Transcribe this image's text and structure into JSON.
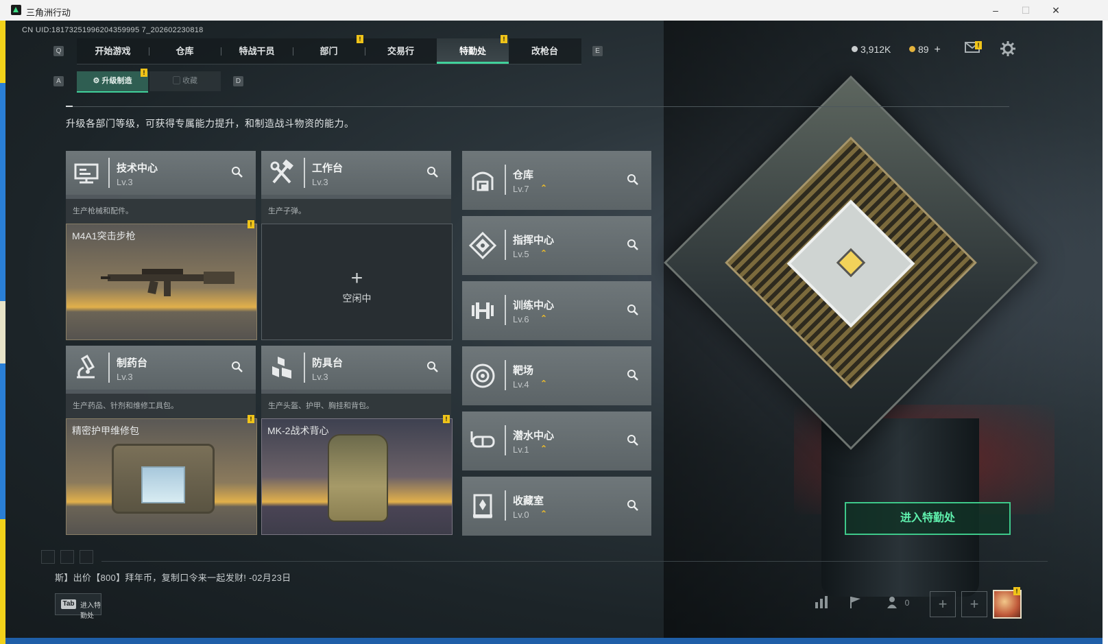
{
  "window": {
    "title": "三角洲行动",
    "minimize": "–",
    "maximize": "☐",
    "close": "✕"
  },
  "uid": "CN UID:18173251996204359995 7_202602230818",
  "nav": {
    "left_key": "Q",
    "right_key": "E",
    "tabs": [
      "开始游戏",
      "仓库",
      "特战干员",
      "部门",
      "交易行",
      "特勤处",
      "改枪台"
    ],
    "active": "特勤处",
    "warning_mark": "!"
  },
  "currency": {
    "silver": "3,912K",
    "gold": "89",
    "gold_plus": "+",
    "silver_color": "#c9cdce",
    "gold_color": "#e3b23c"
  },
  "icons": {
    "mail": "mail-icon",
    "settings": "gear-icon",
    "stats": "bar-chart-icon",
    "flag": "flag-icon",
    "friends": "friends-icon"
  },
  "subnav": {
    "left_key": "A",
    "right_key": "D",
    "tabs": [
      "升级制造",
      "收藏"
    ],
    "active": "升级制造"
  },
  "description": "升级各部门等级，可获得专属能力提升，和制造战斗物资的能力。",
  "production": [
    {
      "name": "技术中心",
      "level": "Lv.3",
      "icon": "computer-icon",
      "sub": "生产枪械和配件。",
      "item": "M4A1突击步枪",
      "state": "producing"
    },
    {
      "name": "工作台",
      "level": "Lv.3",
      "icon": "tools-icon",
      "sub": "生产子弹。",
      "item": "",
      "state": "idle",
      "idle_label": "空闲中",
      "idle_plus": "+"
    },
    {
      "name": "制药台",
      "level": "Lv.3",
      "icon": "microscope-icon",
      "sub": "生产药品、针剂和维修工具包。",
      "item": "精密护甲维修包",
      "state": "producing"
    },
    {
      "name": "防具台",
      "level": "Lv.3",
      "icon": "armor-icon",
      "sub": "生产头盔、护甲、胸挂和背包。",
      "item": "MK-2战术背心",
      "state": "producing"
    }
  ],
  "departments": [
    {
      "name": "仓库",
      "level": "Lv.7",
      "icon": "warehouse-icon"
    },
    {
      "name": "指挥中心",
      "level": "Lv.5",
      "icon": "command-icon"
    },
    {
      "name": "训练中心",
      "level": "Lv.6",
      "icon": "dumbbell-icon"
    },
    {
      "name": "靶场",
      "level": "Lv.4",
      "icon": "target-icon"
    },
    {
      "name": "潜水中心",
      "level": "Lv.1",
      "icon": "goggles-icon"
    },
    {
      "name": "收藏室",
      "level": "Lv.0",
      "icon": "trophy-icon"
    }
  ],
  "upgrade_mark": "⌃",
  "enter_button": "进入特勤处",
  "ticker": "斯】出价【800】拜年币，复制口令来一起发财! -02月23日",
  "tab_hint": {
    "key": "Tab",
    "label": "进入特勤处"
  },
  "friends_count": "0",
  "plus_slot": "+"
}
